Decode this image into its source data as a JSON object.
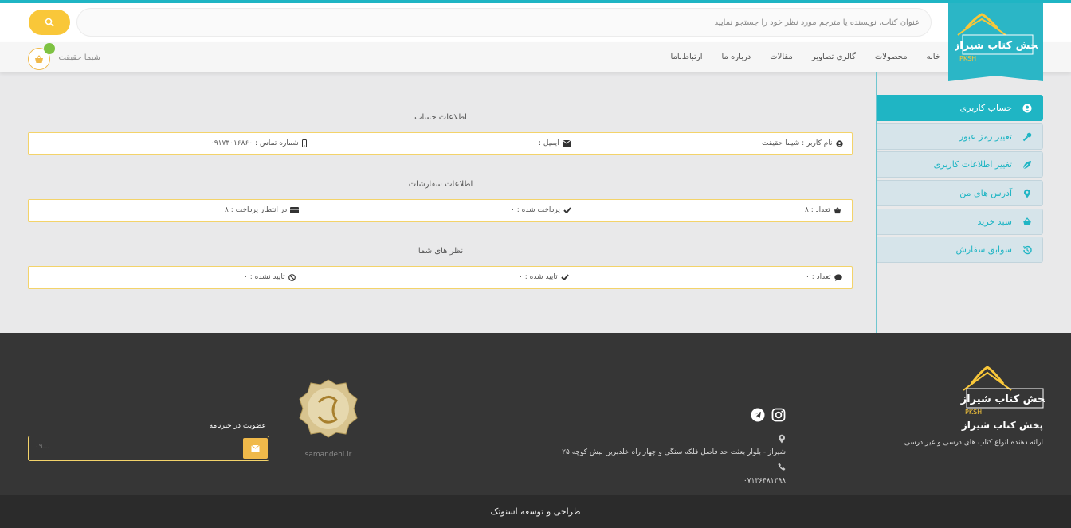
{
  "header": {
    "search_placeholder": "عنوان کتاب، نویسنده یا مترجم مورد نظر خود را جستجو نمایید",
    "logo_text": "پخش کتاب شیراز",
    "logo_sub": "PKSH",
    "nav": [
      "خانه",
      "محصولات",
      "گالری تصاویر",
      "مقالات",
      "درباره ما",
      "ارتباط‌با‌ما"
    ],
    "user_name": "شیما حقیقت",
    "cart_count": "۰"
  },
  "sidebar": {
    "items": [
      {
        "label": "حساب کاربری",
        "icon": "user-circle-icon"
      },
      {
        "label": "تغییر رمز عبور",
        "icon": "key-icon"
      },
      {
        "label": "تغییر اطلاعات کاربری",
        "icon": "leaf-icon"
      },
      {
        "label": "آدرس های من",
        "icon": "map-pin-icon"
      },
      {
        "label": "سبد خرید",
        "icon": "basket-icon"
      },
      {
        "label": "سوابق سفارش",
        "icon": "history-icon"
      }
    ]
  },
  "account": {
    "title": "اطلاعات حساب",
    "username": "نام کاربر : شیما حقیقت",
    "email": "ایمیل :",
    "phone": "شماره تماس : ۰۹۱۷۳۰۱۶۸۶۰"
  },
  "orders": {
    "title": "اطلاعات سفارشات",
    "count": "تعداد : ۸",
    "paid": "پرداخت شده : ۰",
    "pending": "در انتظار پرداخت : ۸"
  },
  "comments": {
    "title": "نظر های شما",
    "count": "تعداد : ۰",
    "approved": "تایید شده : ۰",
    "not_approved": "تایید نشده : ۰"
  },
  "footer": {
    "brand": "پخش کتاب شیراز",
    "tagline": "ارائه دهنده انواع کتاب های درسی و غیر درسی",
    "address": "شیراز - بلوار بعثت حد فاصل فلکه سنگی و چهار راه خلدبرین نبش کوچه ۲۵",
    "phone": "۰۷۱۳۶۴۸۱۳۹۸",
    "newsletter_title": "عضویت در خبرنامه",
    "newsletter_placeholder": "۰۹...",
    "seal_text": "samandehi.ir",
    "credit": "طراحی و توسعه اسنوتک"
  },
  "colors": {
    "accent": "#1fb5c4",
    "yellow": "#f9c739",
    "footer": "#363636"
  }
}
